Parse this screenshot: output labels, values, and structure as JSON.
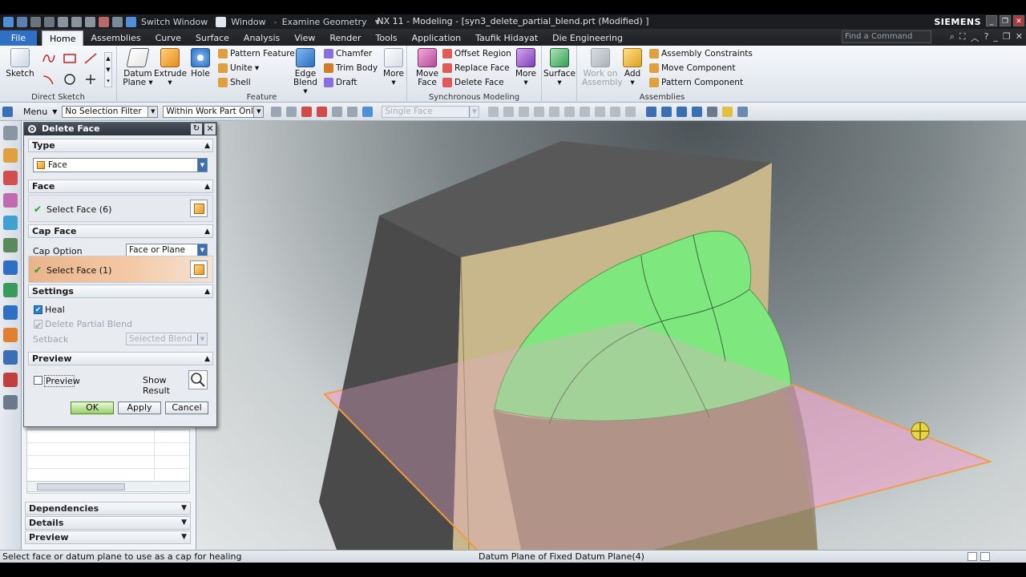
{
  "titlebar": {
    "switch_window": "Switch Window",
    "window": "Window",
    "examine_geometry": "Examine Geometry",
    "title": "NX 11 - Modeling - [syn3_delete_partial_blend.prt (Modified) ]",
    "brand": "SIEMENS"
  },
  "menubar": {
    "file": "File",
    "items": [
      "Home",
      "Assemblies",
      "Curve",
      "Surface",
      "Analysis",
      "View",
      "Render",
      "Tools",
      "Application",
      "Taufik Hidayat",
      "Die Engineering"
    ],
    "find_placeholder": "Find a Command"
  },
  "ribbon": {
    "direct_sketch": {
      "label": "Direct Sketch",
      "sketch": "Sketch"
    },
    "feature": {
      "label": "Feature",
      "datum_plane": "Datum Plane",
      "extrude": "Extrude",
      "hole": "Hole",
      "pattern_feature": "Pattern Feature",
      "unite": "Unite",
      "shell": "Shell",
      "edge_blend": "Edge Blend",
      "chamfer": "Chamfer",
      "trim_body": "Trim Body",
      "draft": "Draft",
      "more": "More"
    },
    "sync": {
      "label": "Synchronous Modeling",
      "move_face": "Move Face",
      "offset_region": "Offset Region",
      "replace_face": "Replace Face",
      "delete_face": "Delete Face",
      "more": "More"
    },
    "surface": {
      "surface": "Surface"
    },
    "assemblies": {
      "label": "Assemblies",
      "work_on_assembly": "Work on Assembly",
      "add": "Add",
      "assembly_constraints": "Assembly Constraints",
      "move_component": "Move Component",
      "pattern_component": "Pattern Component"
    }
  },
  "toolbar": {
    "menu": "Menu",
    "selection_filter": "No Selection Filter",
    "scope": "Within Work Part Only",
    "face_rule": "Single Face"
  },
  "dialog": {
    "title": "Delete Face",
    "type_section": "Type",
    "type_value": "Face",
    "face_section": "Face",
    "select_face": "Select Face (6)",
    "cap_section": "Cap Face",
    "cap_option_label": "Cap Option",
    "cap_option_value": "Face or Plane",
    "select_cap_face": "Select Face (1)",
    "settings_section": "Settings",
    "heal": "Heal",
    "delete_partial_blend": "Delete Partial Blend",
    "setback_label": "Setback",
    "setback_value": "Selected Blend",
    "preview_section": "Preview",
    "preview": "Preview",
    "show_result": "Show Result",
    "ok": "OK",
    "apply": "Apply",
    "cancel": "Cancel"
  },
  "navigator": {
    "dependencies": "Dependencies",
    "details": "Details",
    "preview": "Preview"
  },
  "status": {
    "prompt": "Select face or datum plane to use as a cap for healing",
    "info": "Datum Plane of Fixed Datum Plane(4)"
  },
  "colors": {
    "accent": "#2f6fc4",
    "selection_green": "#7ee87e",
    "datum_plane": "#e9a8c9",
    "datum_edge": "#f29a3a",
    "solid_tan": "#c7b78a",
    "solid_dark": "#505050"
  }
}
